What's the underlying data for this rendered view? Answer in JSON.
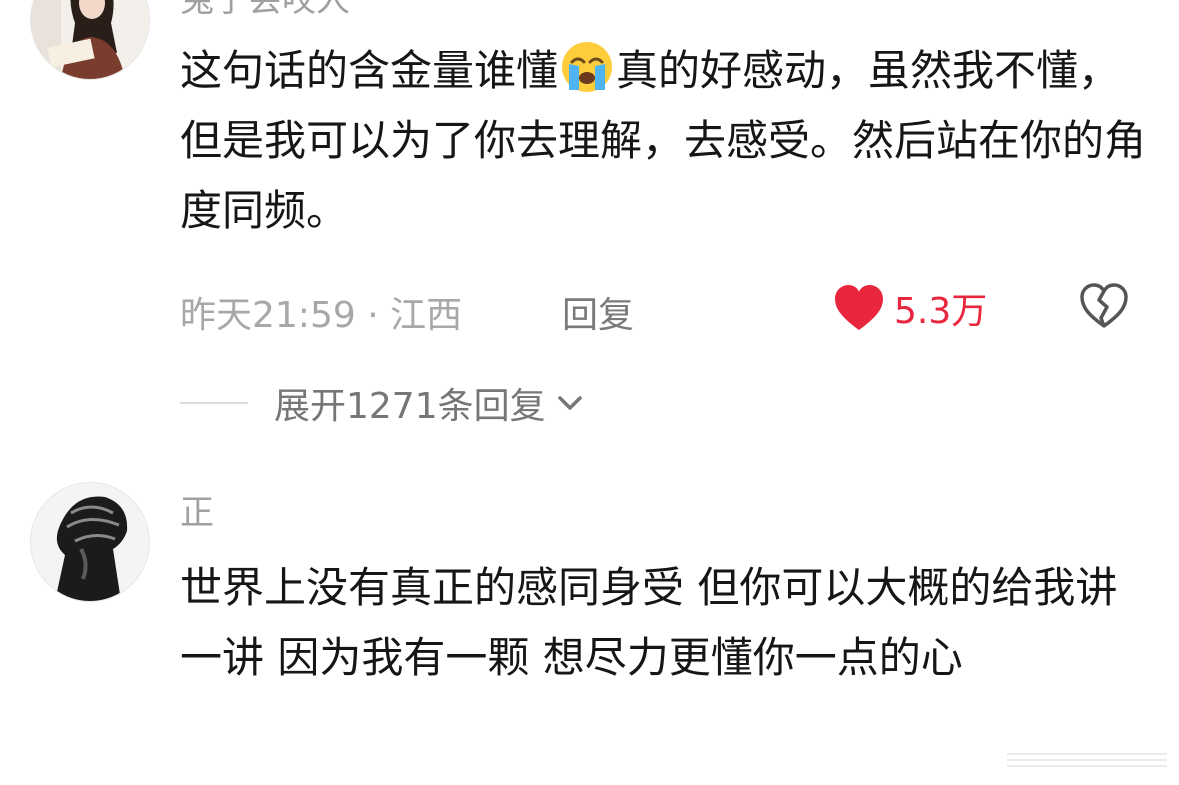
{
  "comments": [
    {
      "username": "兔子会咬人",
      "text_before_emoji": "这句话的含金量谁懂",
      "emoji": "loudly-crying-face",
      "text_after_emoji": "真的好感动，虽然我不懂，但是我可以为了你去理解，去感受。然后站在你的角度同频。",
      "time_location": "昨天21:59 · 江西",
      "reply_label": "回复",
      "like_count": "5.3万",
      "icons": {
        "like": "heart-icon",
        "dislike": "broken-heart-icon"
      },
      "expand_label": "展开1271条回复"
    },
    {
      "username": "正",
      "text": "世界上没有真正的感同身受 但你可以大概的给我讲一讲 因为我有一颗 想尽力更懂你一点的心"
    }
  ],
  "colors": {
    "like": "#e8263d",
    "body_text": "#161616",
    "meta_text": "#a8a8a8"
  }
}
